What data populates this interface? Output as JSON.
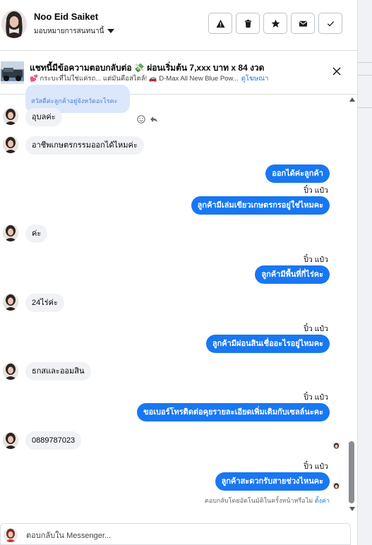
{
  "header": {
    "name": "Noo Eid Saiket",
    "subtitle": "มอบหมายการสนทนานี้",
    "buttons": [
      {
        "icon": "warning-icon"
      },
      {
        "icon": "trash-icon"
      },
      {
        "icon": "star-icon"
      },
      {
        "icon": "mail-icon"
      },
      {
        "icon": "check-icon"
      }
    ]
  },
  "ad": {
    "title": "แชทนี้มีข้อความตอบกลับต่อ 💸 ผ่อนเริ่มต้น 7,xxx บาท x 84 งวด",
    "line": "💕 กระบะที่ไม่ใช่แค่รถ... แต่มันคือสไตล์! 🚗 D-Max All New Blue Pow...",
    "sponsored": "ดูโฆษณา"
  },
  "messages": {
    "quoted": "สวัสดีค่ะลูกค้าอยู่จังหวัดอะไรคะ",
    "in": [
      {
        "text": "อุบลค่ะ"
      },
      {
        "text": "อาชีพเกษตรกรรมออกได้ไหมค่ะ"
      },
      {
        "text": "ค่ะ"
      },
      {
        "text": "24ไร่ค่ะ"
      },
      {
        "text": "ธกสและออมสิน"
      },
      {
        "text": "0889787023"
      }
    ],
    "out": [
      {
        "text": "ออกได้ค่ะลูกค้า"
      },
      {
        "text": "ลูกค้ามีเล่มเขียวเกษตรกรอยู่ใช่ไหมคะ"
      },
      {
        "text": "ลูกค้ามีพื้นที่กี่ไร่คะ"
      },
      {
        "text": "ลูกค้ามีผ่อนสินเชื่ออะไรอยู่ไหมคะ"
      },
      {
        "text": "ขอเบอร์โทรติดต่อคุยรายละเอียดเพิ่มเติมกับเซลล์นะคะ"
      },
      {
        "text": "ลูกค้าสะดวกรับสายช่วงไหนคะ"
      }
    ],
    "sender_label": "ปิ๋ว แป๋ว",
    "auto_note": "ตอบกลับโดยอัตโนมัติในครั้งหน้าหรือไม่",
    "auto_note_link": "ตั้งค่า"
  },
  "composer": {
    "placeholder": "ตอบกลับใน Messenger..."
  },
  "colors": {
    "accent": "#1877f2",
    "incoming_bubble": "#f0f2f5",
    "quoted_bubble": "#dbe7fb"
  }
}
